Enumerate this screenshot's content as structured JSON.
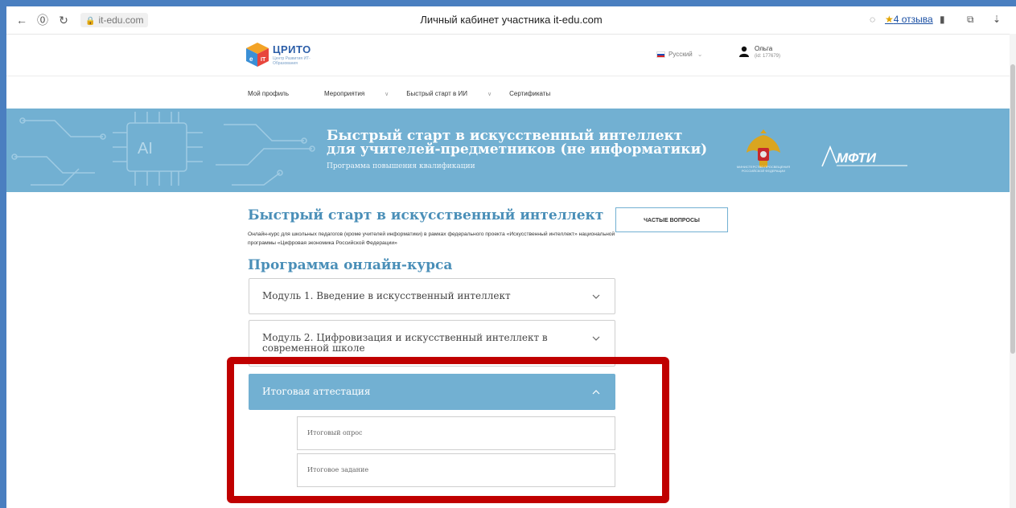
{
  "browser": {
    "url": "it-edu.com",
    "window_title": "Личный кабинет участника it-edu.com",
    "reviews_label": "4 отзыва"
  },
  "site": {
    "logo_text": "ЦРИТО",
    "logo_subtitle": "Центр Развития ИТ-Образования",
    "language": "Русский",
    "user_name": "Ольга",
    "user_id": "(id: 177679)"
  },
  "menu": {
    "items": [
      {
        "label": "Мой профиль",
        "has_dropdown": false
      },
      {
        "label": "Мероприятия",
        "has_dropdown": true
      },
      {
        "label": "Быстрый старт в ИИ",
        "has_dropdown": true
      },
      {
        "label": "Сертификаты",
        "has_dropdown": false
      }
    ]
  },
  "banner": {
    "title": "Быстрый старт в искусственный интеллект для учителей-предметников (не информатики)",
    "subtitle": "Программа повышения квалификации",
    "emblem_text": "МИНИСТЕРСТВО ПРОСВЕЩЕНИЯ РОССИЙСКОЙ ФЕДЕРАЦИИ",
    "partner_text": "МФТИ",
    "decor_text": "AI"
  },
  "course": {
    "title": "Быстрый старт в искусственный интеллект",
    "description": "Онлайн-курс для школьных педагогов (кроме учителей информатики) в рамках федерального проекта «Искусственный интеллект» национальной программы «Цифровая экономика Российской Федерации»",
    "faq_label": "ЧАСТЫЕ ВОПРОСЫ",
    "program_title": "Программа онлайн-курса",
    "modules": [
      {
        "label": "Модуль 1. Введение в искусственный интеллект",
        "expanded": false
      },
      {
        "label": "Модуль 2. Цифровизация и искусственный интеллект в современной школе",
        "expanded": false
      },
      {
        "label": "Итоговая аттестация",
        "expanded": true
      }
    ],
    "final_items": [
      {
        "label": "Итоговый опрос"
      },
      {
        "label": "Итоговое задание"
      }
    ]
  },
  "colors": {
    "accent": "#72b0d2",
    "title": "#4a8fb8",
    "highlight": "#c00000",
    "background": "#4a7fc0"
  }
}
